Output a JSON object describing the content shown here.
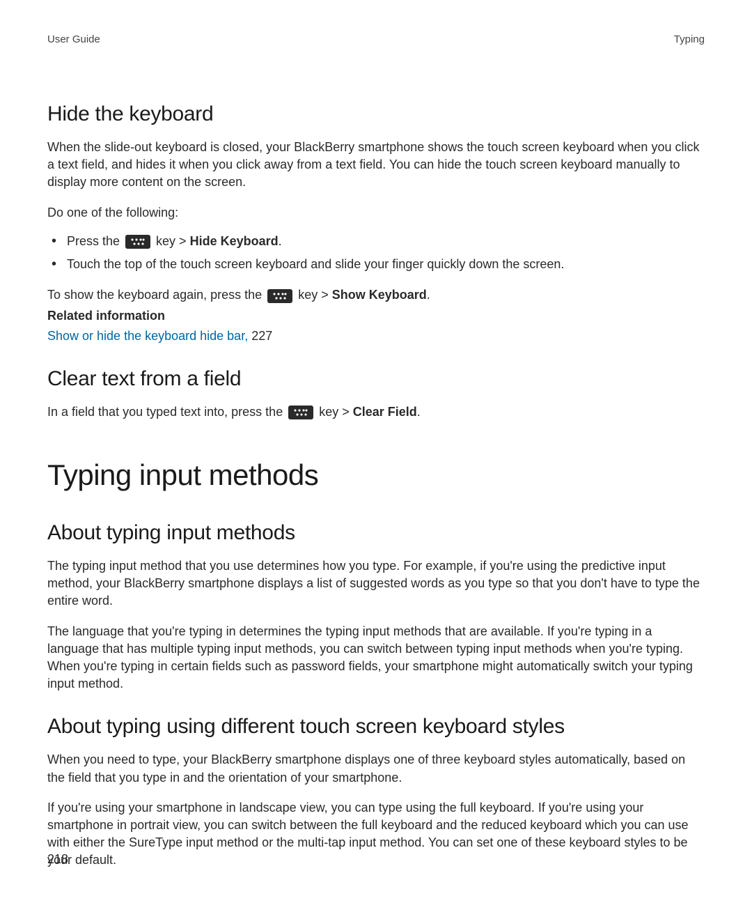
{
  "header": {
    "left": "User Guide",
    "right": "Typing"
  },
  "section1": {
    "heading": "Hide the keyboard",
    "p1": "When the slide-out keyboard is closed, your BlackBerry smartphone shows the touch screen keyboard when you click a text field, and hides it when you click away from a text field. You can hide the touch screen keyboard manually to display more content on the screen.",
    "p2": "Do one of the following:",
    "li1_before": "Press the ",
    "li1_after": " key > ",
    "li1_bold": "Hide Keyboard",
    "li1_end": ".",
    "li2": "Touch the top of the touch screen keyboard and slide your finger quickly down the screen.",
    "p3_before": "To show the keyboard again, press the ",
    "p3_after": " key > ",
    "p3_bold": "Show Keyboard",
    "p3_end": ".",
    "related_label": "Related information",
    "related_link": "Show or hide the keyboard hide bar, ",
    "related_page": "227"
  },
  "section2": {
    "heading": "Clear text from a field",
    "p1_before": "In a field that you typed text into, press the ",
    "p1_after": " key > ",
    "p1_bold": "Clear Field",
    "p1_end": "."
  },
  "main_heading": "Typing input methods",
  "section3": {
    "heading": "About typing input methods",
    "p1": "The typing input method that you use determines how you type. For example, if you're using the predictive input method, your BlackBerry smartphone displays a list of suggested words as you type so that you don't have to type the entire word.",
    "p2": "The language that you're typing in determines the typing input methods that are available. If you're typing in a language that has multiple typing input methods, you can switch between typing input methods when you're typing. When you're typing in certain fields such as password fields, your smartphone might automatically switch your typing input method."
  },
  "section4": {
    "heading": "About typing using different touch screen keyboard styles",
    "p1": "When you need to type, your BlackBerry smartphone displays one of three keyboard styles automatically, based on the field that you type in and the orientation of your smartphone.",
    "p2": "If you're using your smartphone in landscape view, you can type using the full keyboard. If you're using your smartphone in portrait view, you can switch between the full keyboard and the reduced keyboard which you can use with either the SureType input method or the multi-tap input method. You can set one of these keyboard styles to be your default."
  },
  "page_number": "218"
}
